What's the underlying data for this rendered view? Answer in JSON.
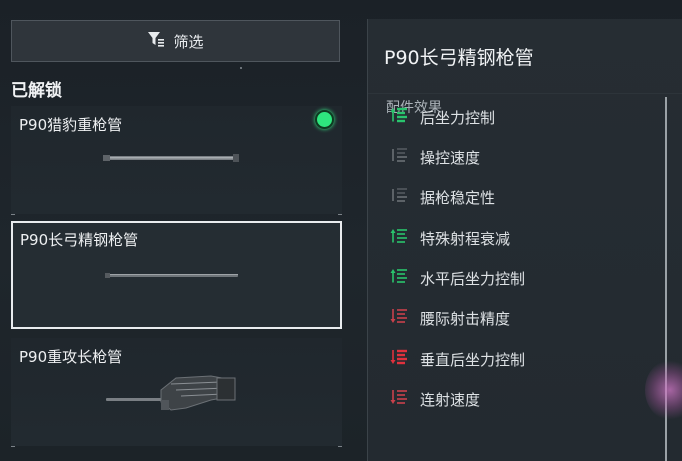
{
  "toolbar": {
    "filter_label": "筛选"
  },
  "unlocked": {
    "title": "已解锁",
    "items": [
      {
        "label": "P90猎豹重枪管",
        "equipped": true,
        "selected": false
      },
      {
        "label": "P90长弓精钢枪管",
        "equipped": false,
        "selected": true
      },
      {
        "label": "P90重攻长枪管",
        "equipped": false,
        "selected": false
      }
    ]
  },
  "detail": {
    "title": "P90长弓精钢枪管",
    "effects_heading": "配件效果",
    "effects": [
      {
        "label": "后坐力控制",
        "icon": "stat-up-icon",
        "color": "#29c46d",
        "strong": true
      },
      {
        "label": "操控速度",
        "icon": "stat-neutral-icon",
        "color": "#6a7075",
        "strong": false
      },
      {
        "label": "据枪稳定性",
        "icon": "stat-neutral-icon",
        "color": "#6a7075",
        "strong": false
      },
      {
        "label": "特殊射程衰减",
        "icon": "stat-up-icon",
        "color": "#29c46d",
        "strong": false
      },
      {
        "label": "水平后坐力控制",
        "icon": "stat-up-icon",
        "color": "#29c46d",
        "strong": false
      },
      {
        "label": "腰际射击精度",
        "icon": "stat-down-icon",
        "color": "#c9414b",
        "strong": false
      },
      {
        "label": "垂直后坐力控制",
        "icon": "stat-down-icon",
        "color": "#e0313d",
        "strong": true
      },
      {
        "label": "连射速度",
        "icon": "stat-down-icon",
        "color": "#c9414b",
        "strong": false
      }
    ]
  },
  "colors": {
    "accent_green": "#2ee67e",
    "negative_red": "#e0313d"
  }
}
